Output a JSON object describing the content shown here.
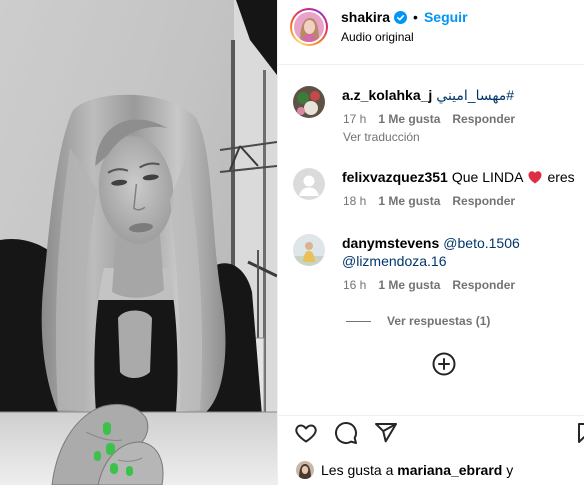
{
  "header": {
    "username": "shakira",
    "verified_icon": "verified-badge-icon",
    "separator": "•",
    "follow_label": "Seguir",
    "audio_label": "Audio original"
  },
  "comments": [
    {
      "username": "a.z_kolahka_j",
      "hashtag": "#مهسا_اميني",
      "time": "17 h",
      "likes": "1 Me gusta",
      "reply_label": "Responder",
      "translate_label": "Ver traducción"
    },
    {
      "username": "felixvazquez351",
      "text_before": "Que LINDA",
      "emoji_icon": "red-heart-emoji-icon",
      "text_after": "eres",
      "avatar_icon": "default-avatar-icon",
      "time": "18 h",
      "likes": "1 Me gusta",
      "reply_label": "Responder"
    },
    {
      "username": "danymstevens",
      "mentions": [
        "@beto.1506",
        "@lizmendoza.16"
      ],
      "time": "16 h",
      "likes": "1 Me gusta",
      "reply_label": "Responder",
      "view_replies_label": "Ver respuestas (1)"
    }
  ],
  "add_comment_icon": "plus-circle-icon",
  "actions": {
    "like_icon": "heart-icon",
    "comment_icon": "comment-icon",
    "share_icon": "share-icon",
    "save_icon": "bookmark-icon"
  },
  "likes_summary": {
    "prefix": "Les gusta a",
    "username": "mariana_ebrard",
    "suffix": "y"
  },
  "colors": {
    "accent": "#0095f6",
    "link": "#00376b",
    "secondary_text": "#737373",
    "divider": "#efefef",
    "nail_green": "#3cc24a",
    "emoji_red": "#dd2e44"
  }
}
